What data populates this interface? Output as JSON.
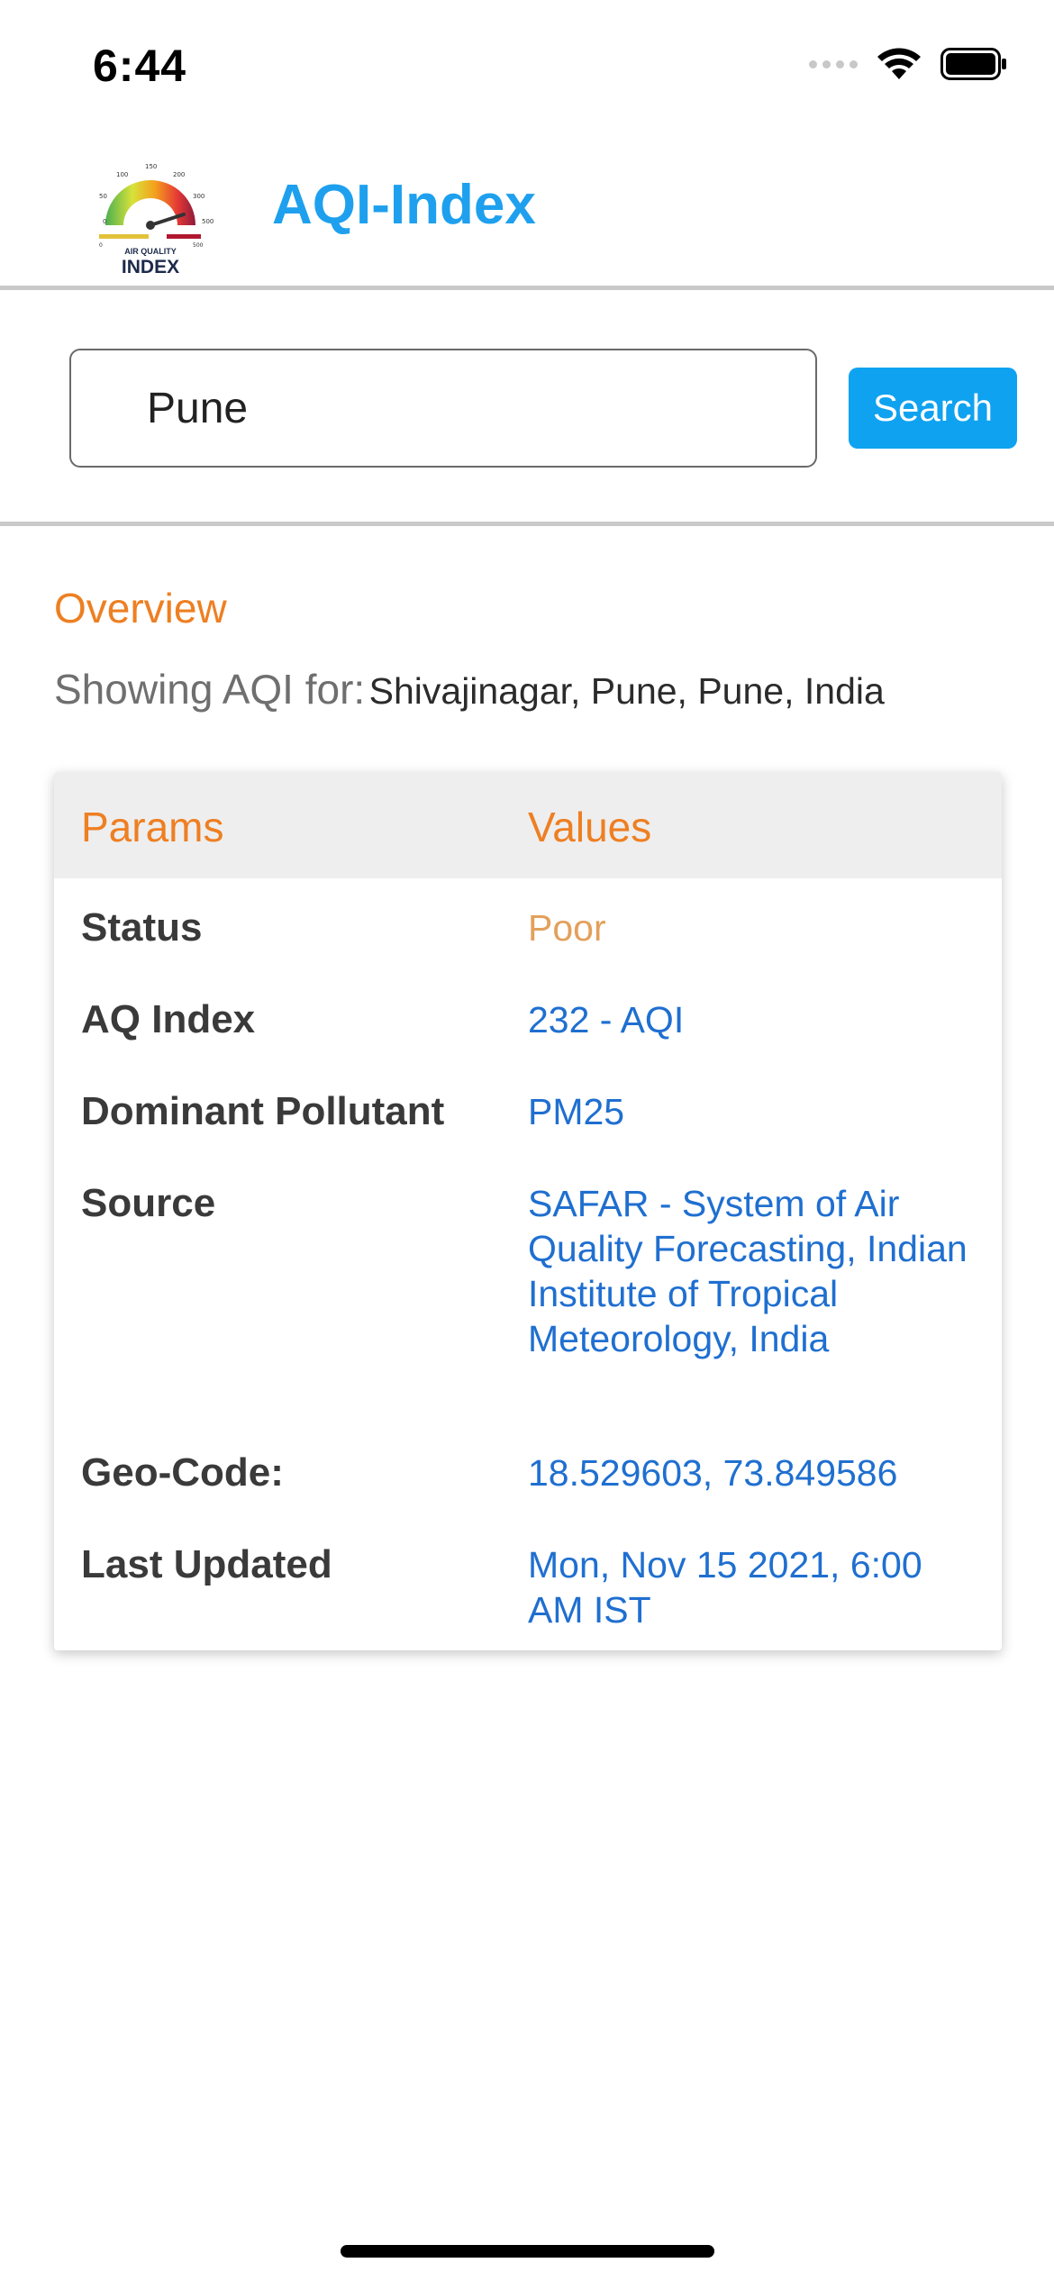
{
  "status_bar": {
    "time": "6:44"
  },
  "header": {
    "title": "AQI-Index",
    "logo": {
      "ticks": [
        "0",
        "50",
        "100",
        "150",
        "200",
        "300",
        "500",
        "0",
        "500"
      ],
      "caption_top": "AIR QUALITY",
      "caption_bottom": "INDEX"
    }
  },
  "search": {
    "value": "Pune",
    "button_label": "Search"
  },
  "overview": {
    "title": "Overview",
    "showing_label": "Showing AQI for:",
    "location": "Shivajinagar, Pune, Pune, India"
  },
  "table": {
    "headers": [
      "Params",
      "Values"
    ],
    "rows": [
      {
        "label": "Status",
        "value": "Poor"
      },
      {
        "label": "AQ Index",
        "value": "232 - AQI"
      },
      {
        "label": "Dominant Pollutant",
        "value": "PM25"
      },
      {
        "label": "Source",
        "value": "SAFAR - System of Air Quality Forecasting, Indian Institute of Tropical Meteorology, India"
      },
      {
        "label": "Geo-Code:",
        "value": "18.529603, 73.849586"
      },
      {
        "label": "Last Updated",
        "value": "Mon, Nov 15 2021, 6:00 AM IST"
      }
    ]
  },
  "colors": {
    "accent_blue": "#1ea0ee",
    "search_button": "#0fa2f0",
    "orange": "#ee7f22",
    "value_blue": "#1f6fd0",
    "status_poor": "#e3a05c"
  }
}
